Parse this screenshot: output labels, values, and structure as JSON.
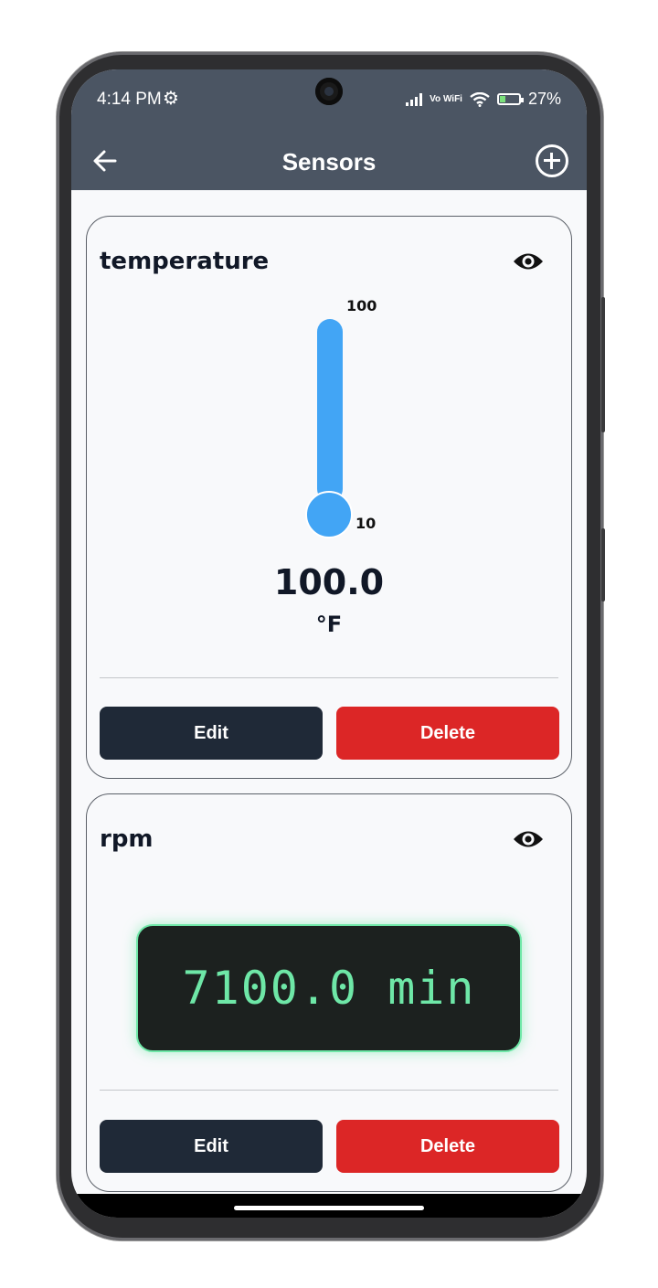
{
  "status_bar": {
    "time": "4:14 PM",
    "network": "Vo WiFi",
    "battery": "27%"
  },
  "app_bar": {
    "title": "Sensors"
  },
  "sensors": [
    {
      "name": "temperature",
      "widget": "thermometer",
      "max_label": "100",
      "min_label": "10",
      "value": "100.0",
      "unit": "°F",
      "edit_label": "Edit",
      "delete_label": "Delete"
    },
    {
      "name": "rpm",
      "widget": "digital-display",
      "display_text": "7100.0 min",
      "edit_label": "Edit",
      "delete_label": "Delete"
    }
  ],
  "colors": {
    "header": "#4b5563",
    "edit_button": "#1f2937",
    "delete_button": "#dc2626",
    "thermometer": "#42a5f5",
    "digital_text": "#6ee7a7"
  }
}
